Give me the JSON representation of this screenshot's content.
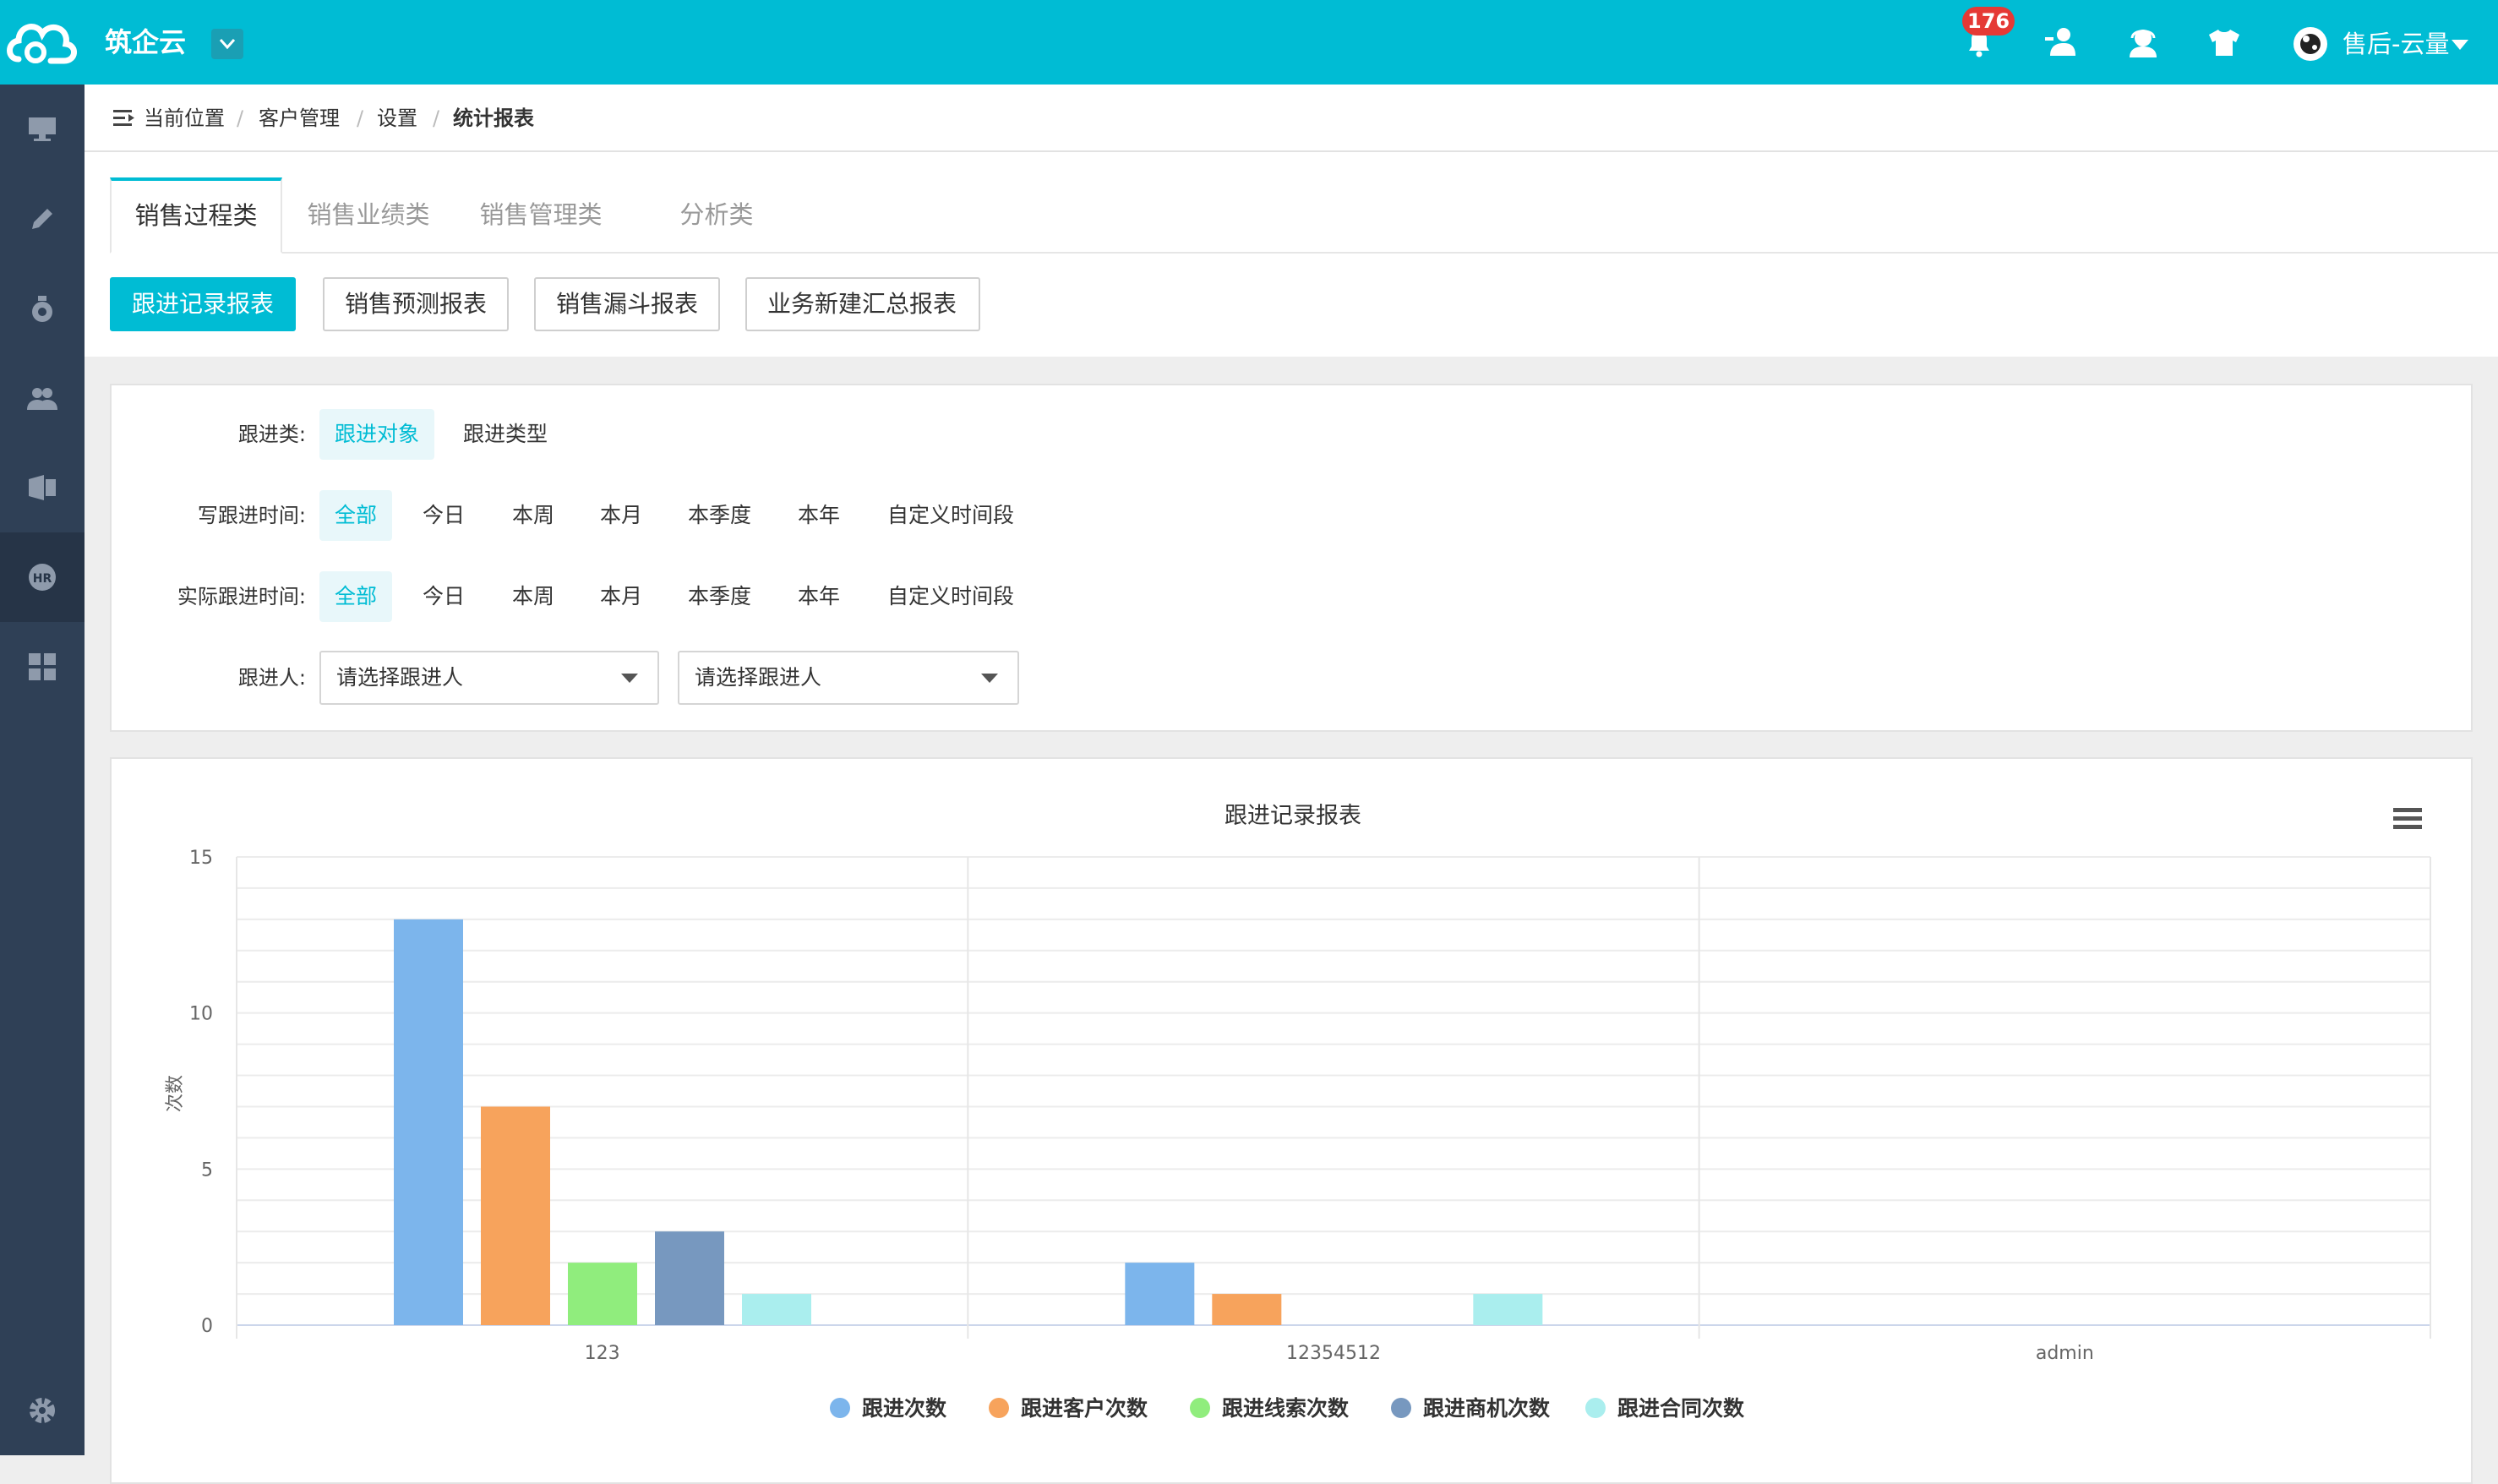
{
  "app": {
    "brand": "筑企云",
    "notif_count": "176",
    "user_name": "售后-云量"
  },
  "breadcrumb": [
    "当前位置",
    "客户管理",
    "设置",
    "统计报表"
  ],
  "tabs": [
    "销售过程类",
    "销售业绩类",
    "销售管理类",
    "分析类"
  ],
  "report_buttons": [
    "跟进记录报表",
    "销售预测报表",
    "销售漏斗报表",
    "业务新建汇总报表"
  ],
  "filters": {
    "category": {
      "label": "跟进类:",
      "options": [
        "跟进对象",
        "跟进类型"
      ]
    },
    "write_time": {
      "label": "写跟进时间:",
      "options": [
        "全部",
        "今日",
        "本周",
        "本月",
        "本季度",
        "本年",
        "自定义时间段"
      ]
    },
    "actual_time": {
      "label": "实际跟进时间:",
      "options": [
        "全部",
        "今日",
        "本周",
        "本月",
        "本季度",
        "本年",
        "自定义时间段"
      ]
    },
    "person": {
      "label": "跟进人:",
      "placeholder1": "请选择跟进人",
      "placeholder2": "请选择跟进人"
    }
  },
  "colors": {
    "accent": "#00bcd4",
    "sidebar": "#2f4056",
    "badge": "#e53935"
  },
  "chart_data": {
    "type": "bar",
    "title": "跟进记录报表",
    "xlabel": "",
    "ylabel": "次数",
    "ylim": [
      0,
      15
    ],
    "yticks": [
      0,
      5,
      10,
      15
    ],
    "grid": true,
    "legend": "bottom",
    "categories": [
      "123",
      "12354512",
      "admin"
    ],
    "series": [
      {
        "name": "跟进次数",
        "color": "#7cb5ec",
        "values": [
          13,
          2,
          0
        ]
      },
      {
        "name": "跟进客户次数",
        "color": "#f7a35c",
        "values": [
          7,
          1,
          0
        ]
      },
      {
        "name": "跟进线索次数",
        "color": "#90ed7d",
        "values": [
          2,
          0,
          0
        ]
      },
      {
        "name": "跟进商机次数",
        "color": "#7798bf",
        "values": [
          3,
          0,
          0
        ]
      },
      {
        "name": "跟进合同次数",
        "color": "#aaeeee",
        "values": [
          1,
          1,
          0
        ]
      }
    ]
  }
}
